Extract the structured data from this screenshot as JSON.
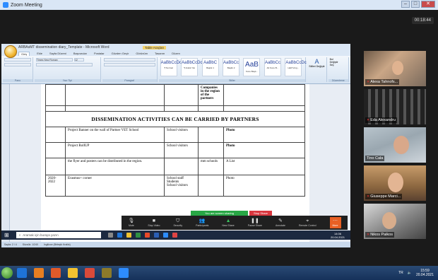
{
  "zoom": {
    "window_title": "Zoom Meeting",
    "timer": "00:18:44",
    "share_banner": "You are screen sharing",
    "stop_share": "Stop Share",
    "toolbar": [
      {
        "label": "Mute",
        "icon": "microphone-icon"
      },
      {
        "label": "Stop Video",
        "icon": "video-camera-icon"
      },
      {
        "label": "Security",
        "icon": "shield-icon"
      },
      {
        "label": "Participants",
        "icon": "people-icon"
      },
      {
        "label": "New Share",
        "icon": "share-icon"
      },
      {
        "label": "Pause Share",
        "icon": "pause-icon"
      },
      {
        "label": "Annotate",
        "icon": "pen-icon"
      },
      {
        "label": "Remote Control",
        "icon": "remote-icon"
      },
      {
        "label": "More",
        "icon": "more-icon"
      }
    ]
  },
  "word": {
    "title": "ARBAsMT dissemination diary_Template - Microsoft Word",
    "tools_tab": "Table Araçları",
    "tabs": [
      "Giriş",
      "Ekle",
      "Sayfa Düzeni",
      "Başvurular",
      "Postalar",
      "Gözden Geçir",
      "Görünüm",
      "Tasarım",
      "Düzen"
    ],
    "font_name": "Times New Roman",
    "font_size": "12",
    "groups": [
      "Pano",
      "Yazı Tipi",
      "Paragraf",
      "Stiller",
      "Düzenleme"
    ],
    "styles": [
      {
        "sample": "AaBbCcDc",
        "name": "¶ Normal"
      },
      {
        "sample": "AaBbCcDc",
        "name": "¶ Aralık Yok"
      },
      {
        "sample": "AaBbC",
        "name": "Başlık 1"
      },
      {
        "sample": "AaBbCc",
        "name": "Başlık 2"
      },
      {
        "sample": "AaB",
        "name": "Konu Başlı..."
      },
      {
        "sample": "AaBbCc",
        "name": "Alt Konu B..."
      },
      {
        "sample": "AaBbCcDc",
        "name": "Hafif Vurg..."
      }
    ],
    "change_styles": "Stilleri Değiştir",
    "editing": [
      "Bul",
      "Değiştir",
      "Seç"
    ],
    "status": [
      "Sayfa: 2 / 4",
      "Sözcük: 1/240",
      "İngilizce (Birleşik Krallık)"
    ]
  },
  "doc": {
    "top_row": [
      "",
      "",
      "",
      "Companies in the region of the partners",
      ""
    ],
    "section_title": "DISSEMINATION   ACTIVITIES   CAN BE CARRIED BY PARTNERS",
    "rows": [
      {
        "date": "",
        "activity": "Project Banner on  the wall of  Partner  VET School",
        "target": "School visitors",
        "who": "",
        "evidence": "Photo"
      },
      {
        "date": "",
        "activity": "Project RollUP",
        "target": "School visitors",
        "who": "",
        "evidence": "Photo"
      },
      {
        "date": "",
        "activity": "the flyer and posters can be distributed in the region.",
        "target": "",
        "who": "mm schools",
        "evidence": "A List"
      },
      {
        "date": "2020-2022",
        "activity": "Erasmus+ corner",
        "target": "School staff\nStudents\nSchool visitors",
        "who": "",
        "evidence": "Photo"
      }
    ]
  },
  "inner_taskbar": {
    "search_placeholder": "Aramak için buraya yazın",
    "time": "14:06",
    "date": "20.04.2021"
  },
  "participants": [
    {
      "name": "Alexa Tahnofs..."
    },
    {
      "name": "Eda Alexandru"
    },
    {
      "name": "Tino Cala"
    },
    {
      "name": "Giuseppe Marci..."
    },
    {
      "name": "Nikos Paikos"
    }
  ],
  "taskbar": {
    "lang": "TR",
    "time": "15:59",
    "date": "20.04.2021"
  }
}
